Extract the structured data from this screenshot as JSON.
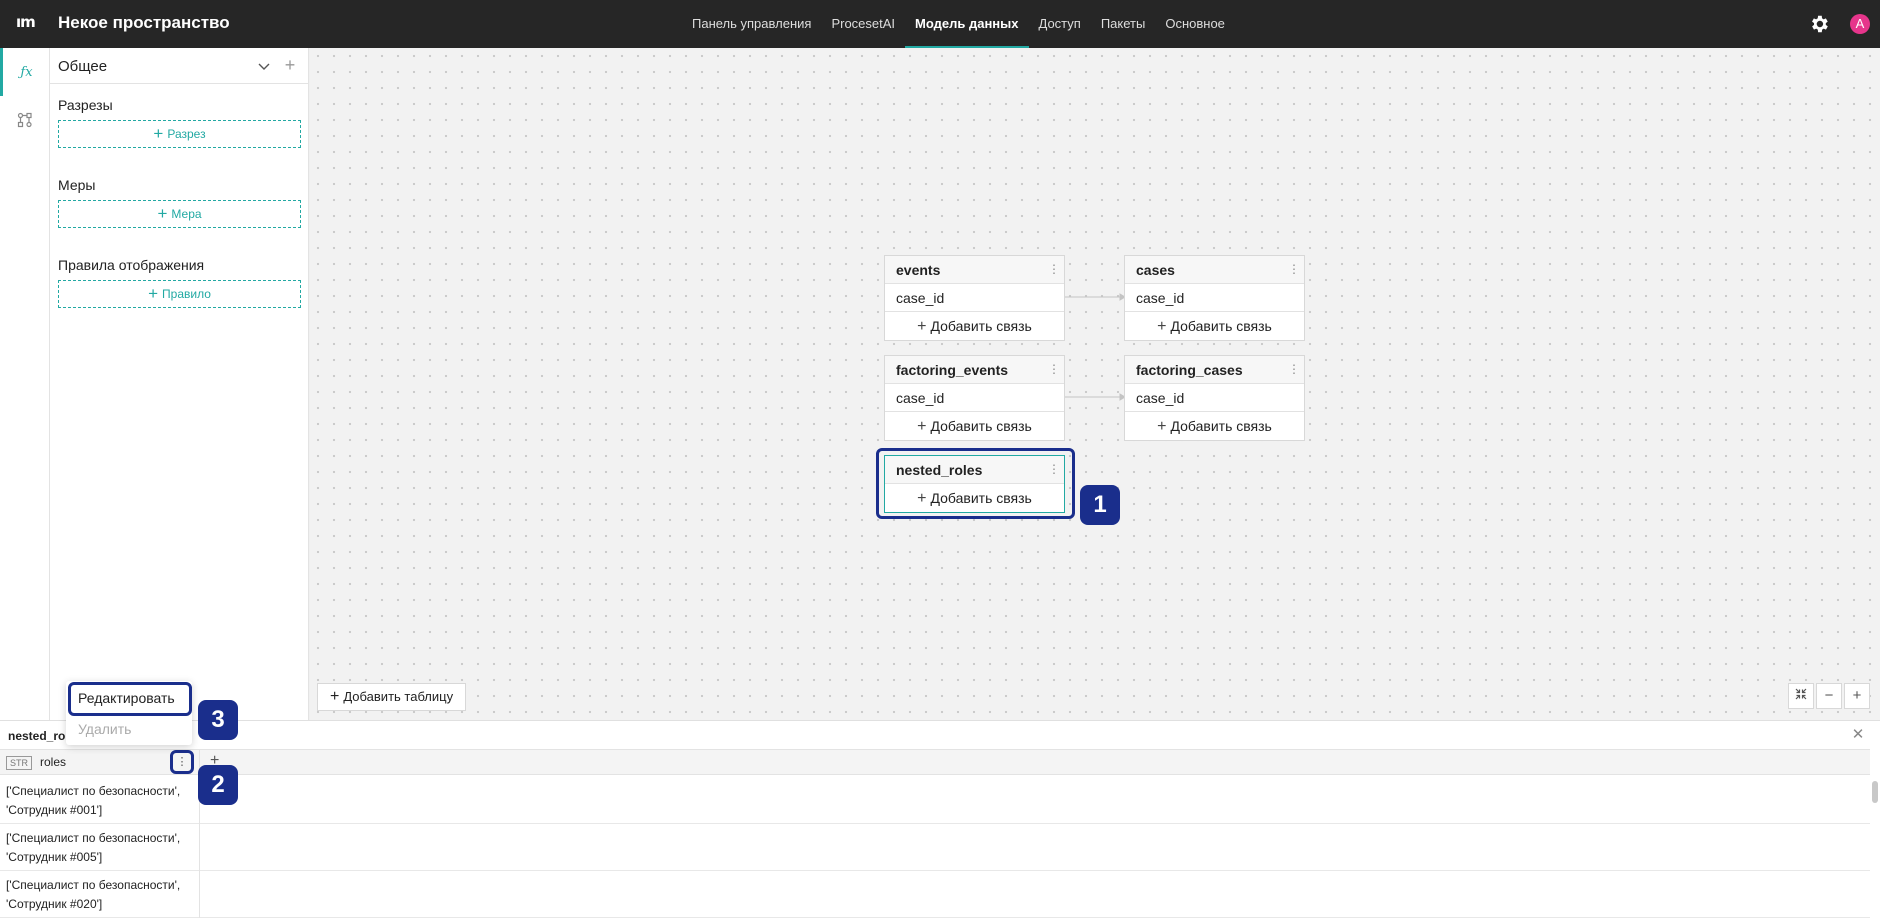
{
  "app": {
    "space_title": "Некое пространство",
    "avatar_initial": "A",
    "accent": "#22a9a3"
  },
  "nav": {
    "items": [
      {
        "label": "Панель управления"
      },
      {
        "label": "ProcesetAI"
      },
      {
        "label": "Модель данных",
        "active": true
      },
      {
        "label": "Доступ"
      },
      {
        "label": "Пакеты"
      },
      {
        "label": "Основное"
      }
    ]
  },
  "rail": {
    "items": [
      {
        "icon": "function-icon",
        "active": true
      },
      {
        "icon": "schema-icon",
        "active": false
      }
    ]
  },
  "panel": {
    "title": "Общее",
    "sections": {
      "slices": {
        "label": "Разрезы",
        "button": "Разрез"
      },
      "measures": {
        "label": "Меры",
        "button": "Мера"
      },
      "rules": {
        "label": "Правила отображения",
        "button": "Правило"
      }
    }
  },
  "canvas": {
    "add_link_label": "Добавить связь",
    "add_table_label": "Добавить таблицу",
    "tables": {
      "events": {
        "name": "events",
        "column": "case_id"
      },
      "cases": {
        "name": "cases",
        "column": "case_id"
      },
      "factoring_events": {
        "name": "factoring_events",
        "column": "case_id"
      },
      "factoring_cases": {
        "name": "factoring_cases",
        "column": "case_id"
      },
      "nested_roles": {
        "name": "nested_roles"
      }
    },
    "annotations": [
      "1",
      "2",
      "3"
    ]
  },
  "preview": {
    "title": "nested_roles",
    "column": {
      "type": "STR",
      "name": "roles"
    },
    "rows": [
      {
        "line1": "['Специалист по безопасности',",
        "line2": "'Сотрудник #001']"
      },
      {
        "line1": "['Специалист по безопасности',",
        "line2": "'Сотрудник #005']"
      },
      {
        "line1": "['Специалист по безопасности',",
        "line2": "'Сотрудник #020']"
      }
    ]
  },
  "context_menu": {
    "edit": "Редактировать",
    "delete": "Удалить"
  },
  "colors": {
    "topbar": "#262626",
    "highlight": "#1a2e8c",
    "avatar": "#e6358b"
  }
}
